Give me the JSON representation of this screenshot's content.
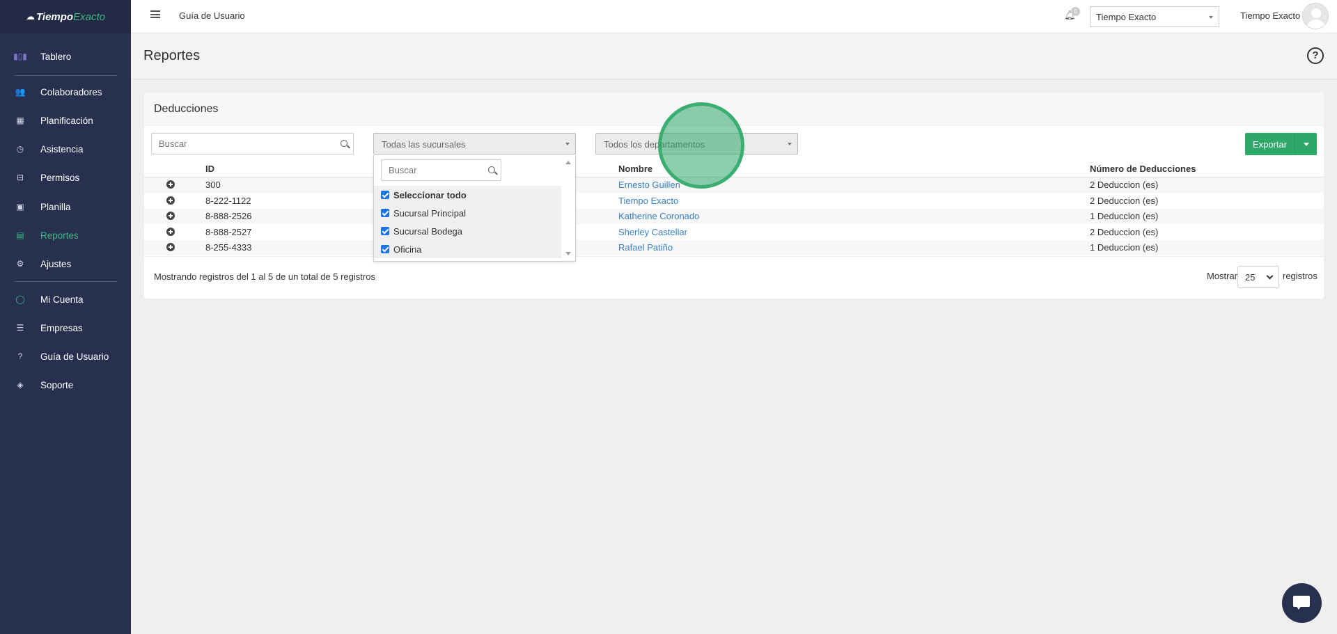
{
  "app": {
    "logo_part1": "Tiempo",
    "logo_part2": "Exacto"
  },
  "sidebar": {
    "items": [
      {
        "label": "Tablero",
        "icon": "bar-chart-icon"
      },
      {
        "label": "Colaboradores",
        "icon": "users-icon"
      },
      {
        "label": "Planificación",
        "icon": "calendar-icon"
      },
      {
        "label": "Asistencia",
        "icon": "clock-icon"
      },
      {
        "label": "Permisos",
        "icon": "inbox-icon"
      },
      {
        "label": "Planilla",
        "icon": "money-icon"
      },
      {
        "label": "Reportes",
        "icon": "file-icon"
      },
      {
        "label": "Ajustes",
        "icon": "gear-icon"
      },
      {
        "label": "Mi Cuenta",
        "icon": "user-icon"
      },
      {
        "label": "Empresas",
        "icon": "sliders-icon"
      },
      {
        "label": "Guía de Usuario",
        "icon": "question-icon"
      },
      {
        "label": "Soporte",
        "icon": "shield-icon"
      }
    ],
    "active": "Reportes",
    "active_color": "#41b883"
  },
  "topbar": {
    "link": "Guía de Usuario",
    "notification_count": "0",
    "company_select": "Tiempo Exacto",
    "user_name": "Tiempo Exacto"
  },
  "page": {
    "title": "Reportes"
  },
  "card": {
    "title": "Deducciones",
    "search_placeholder": "Buscar",
    "branch_select": "Todas las sucursales",
    "department_select": "Todos los departamentos",
    "export_label": "Exportar",
    "export_color": "#2ea869"
  },
  "table": {
    "headers": {
      "id": "ID",
      "name": "Nombre",
      "count": "Número de Deducciones"
    },
    "rows": [
      {
        "id": "300",
        "name": "Ernesto Guillen",
        "count": "2 Deduccion (es)"
      },
      {
        "id": "8-222-1122",
        "name": "Tiempo Exacto",
        "count": "2 Deduccion (es)"
      },
      {
        "id": "8-888-2526",
        "name": "Katherine Coronado",
        "count": "1 Deduccion (es)"
      },
      {
        "id": "8-888-2527",
        "name": "Sherley Castellar",
        "count": "2 Deduccion (es)"
      },
      {
        "id": "8-255-4333",
        "name": "Rafael Patiño",
        "count": "1 Deduccion (es)"
      }
    ],
    "info": "Mostrando registros del 1 al 5 de un total de 5 registros",
    "show_label": "Mostrar",
    "page_length": "25",
    "records_label": "registros"
  },
  "dropdown": {
    "search_placeholder": "Buscar",
    "options": [
      {
        "label": "Seleccionar todo",
        "checked": true
      },
      {
        "label": "Sucursal Principal",
        "checked": true
      },
      {
        "label": "Sucursal Bodega",
        "checked": true
      },
      {
        "label": "Oficina",
        "checked": true
      }
    ]
  }
}
